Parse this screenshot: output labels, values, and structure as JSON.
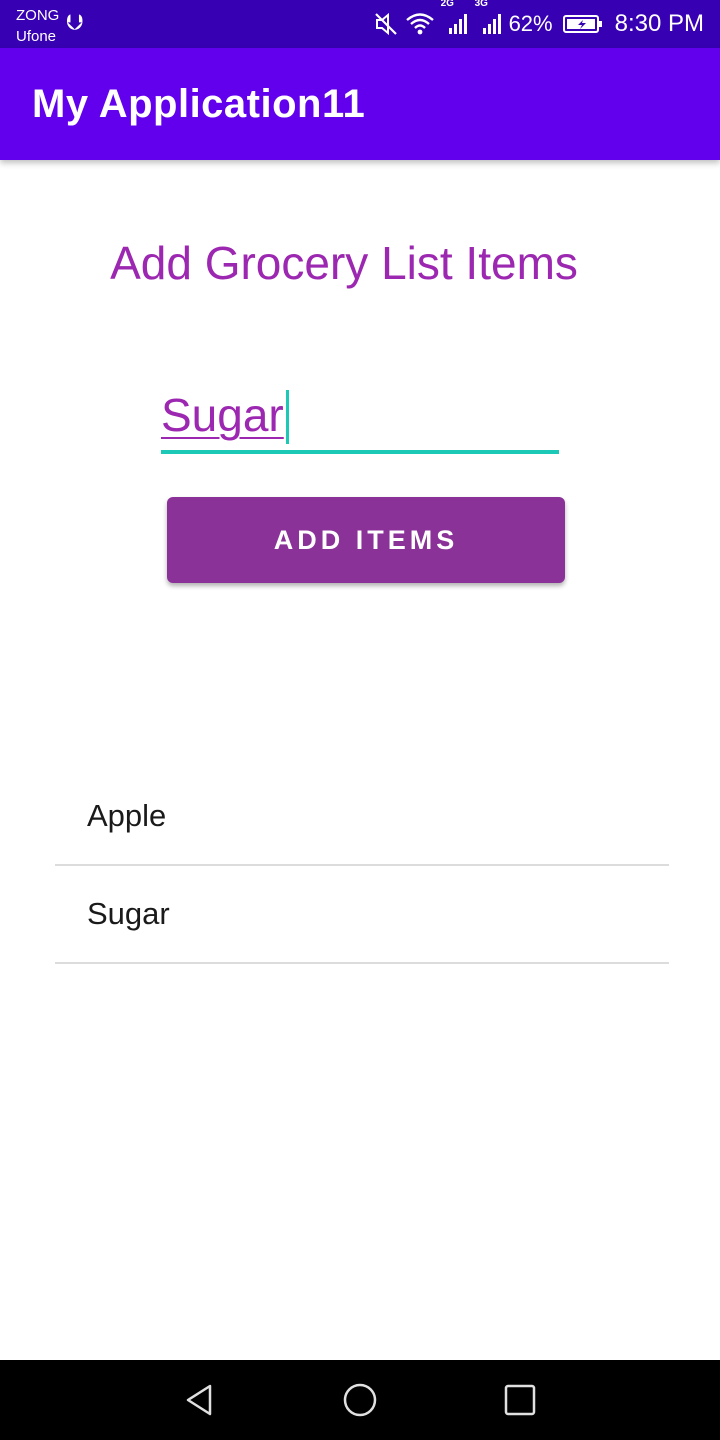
{
  "status_bar": {
    "carrier_1": "ZONG",
    "carrier_2": "Ufone",
    "net_1": "2G",
    "net_2": "3G",
    "battery": "62%",
    "time": "8:30 PM",
    "icons": [
      "usb-icon",
      "mute-icon",
      "wifi-icon",
      "signal-icon",
      "battery-icon"
    ]
  },
  "app_bar": {
    "title": "My Application11",
    "color": "#6200ee"
  },
  "main": {
    "heading": "Add Grocery List Items",
    "input_value": "Sugar",
    "add_button_label": "ADD ITEMS",
    "accent": "#9c27b0"
  },
  "grocery_list": [
    {
      "label": "Apple"
    },
    {
      "label": "Sugar"
    }
  ],
  "nav_bar": {
    "icons": [
      "back-icon",
      "home-icon",
      "recents-icon"
    ]
  }
}
